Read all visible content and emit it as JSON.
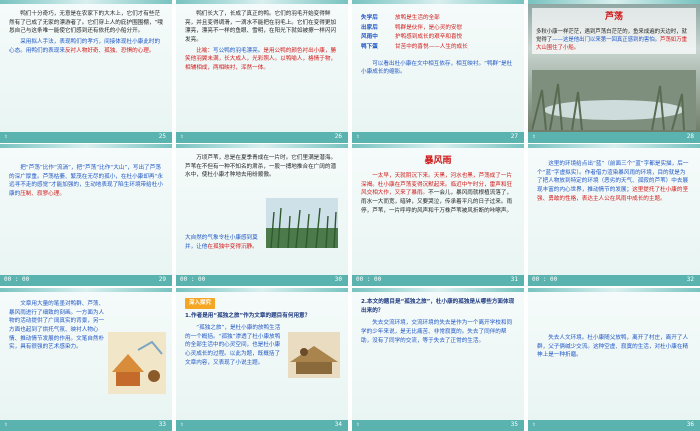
{
  "slides": [
    {
      "num": "25",
      "p1": "鸭们十分奇巧，无意是在农家下的大木上，它们才有些茫然有了已成了无家的漂游者了。它们穿上人的庇护围围棚，“哦恳自己与这条唯一能使它们感到还有依托的小船分开。",
      "p2a": "采用拟人手法，表现鸭们的孝巧，间接体现杜小康此时的心态。用鸭们的表现来",
      "p2b": "反衬人物好奇、孤独、恐惧的心理。"
    },
    {
      "num": "26",
      "p1": "鸭们长大了，长成了真正的鸭。它们的羽毛开始变得鲜亮，并且变得绸滑，一滴水不能把在羽毛上。它们在变得更加漂亮，漂亮不一样的鱼眼、雪明，在阳光下就如被擦一样闪闪发亮。",
      "p2a": "比喻：",
      "p2b": "写公鸭的羽毛漂亮。",
      "p2c": "是用公鸭的颜色衬出小康，勝笑他羽翼未满，长大成人，光彩照人。以鸭喻人，格情于物，相辅相成，两相映衬，浑然一体。"
    },
    {
      "num": "27",
      "rows": [
        [
          "失学后",
          "放鸭是生活的全部"
        ],
        [
          "出家后",
          "鸭群是伙伴，是心灵的安慰"
        ],
        [
          "风雨中",
          "护鸭感到成长的艰辛和喜悦"
        ],
        [
          "鸭下蛋",
          "甘苦中的喜悦——人生的成长"
        ]
      ],
      "p": "可以看出杜小康在文中相互依存，相互映衬。“鸭群”是杜小康成长的缩影。"
    },
    {
      "num": "28",
      "title": "芦荡",
      "p": "多秋小康一样茫茫，遇到芦荡白茫茫的，鱼来成遍的天边时，就觉得了",
      "p2": "——这是他出门以来第一回真正感到的害怕。",
      "p3": "芦荡如万重大山围住了小船。"
    },
    {
      "num": "29",
      "p": "把“芦荡”比作“流淌”，把“芦荡”比作“大山”，写出了芦荡的深广厚重。芦荡枯萎、繁茂在无尽的孤小，在杜小康却再“永远寻不走的感觉”才能加强的，生动地表现了陷生环境带给杜小康的",
      "hl": "压制、寂寥心理。",
      "footl": "00 : 00",
      "footr": "29"
    },
    {
      "num": "30",
      "p": "万顷芦苇，总是在夏季青成在一片时。它们里满是潜海。芦苇在不但有一种不知名的肃杀，一股一搏地推合在广阔的潜水中，使杜小康才种地去用纷顺傲。",
      "p2": "大自然的气象令杜小康感到莫并，让他",
      "hl": "在孤独中变得沉静。",
      "footl": "00 : 00",
      "footr": "30"
    },
    {
      "num": "31",
      "title": "暴风雨",
      "p": "一太早，天就阴沉下来。天黑，河水也黑，芦荡成了一片深褐。杜小康在芦荡变得沉默起来。临近中午时分，雷声和狂风交相大作，又来了暴雨。",
      "p2": "不一会儿，暴风雨就根植流落了，雨水一大而宽，暗钟，又要哭泣，传承着平凡的日子过来。",
      "p3": "雨停，芦苇，一片呼呼的风声和千万株芦苇被风折断的咔嚓声。",
      "footl": "00 : 00",
      "footr": "31"
    },
    {
      "num": "32",
      "p": "这里的环境给点出“蓝”（前面三个“蓝”字都是实描，后一个“蓝”字虚拟实）。作者借力渲染暴风雨的环境，目的就是为了把人物放到特定的环境（恶劣的天气、孤寂的芦苇）中去展现丰富的内心世界，推动情节的发展；",
      "hl": "这里提托了杜小康的坚强、勇敢的性格，表达主人公在风雨中成长的主题。",
      "footl": "00 : 00",
      "footr": "32"
    },
    {
      "num": "33",
      "p": "文章用大量的笔墨对鸭群、芦荡、暴风雨进行了细致的刻画。一方面为人物的活动提供了广阔真实的背景，另一方面也起到了烘托气氛、映衬人物心情、推动情节发展的作用。文笔自然朴实，具有很强的艺术感染力。",
      "footr": "33"
    },
    {
      "num": "34",
      "tag": "深入探究",
      "q": "1.作者是用“孤独之旅”作为文章的题目有何用意？",
      "p": "“孤独之旅”，是杜小康的放鸭生活的一个概括。“孤独”渗透了杜小康放鸭的全部生活中的心灵空间，也是杜小康心灵成长的过程。以此为题，既概括了文章内容，又表现了小说主题。",
      "footr": "34"
    },
    {
      "num": "35",
      "q": "2.本文的题目是“孤独之旅”，杜小康的孤独是从哪些方面体现出来的？",
      "p": "失去交流环境，交流环境的失去是作为一个离开学校和同学的少年来说，是无比痛苦、非常寂寞的。失去了同伴的帮助，没有了同学的交流，等于失去了正常的生活。",
      "footr": "35"
    },
    {
      "num": "36",
      "p": "失去人文环境。杜小康随父放鸭，离开了村庄，离开了人群，父子俩缄少交流。这种空虚、寂寞的生活，对杜小康在精神上是一种折磨。",
      "footr": "36"
    }
  ]
}
